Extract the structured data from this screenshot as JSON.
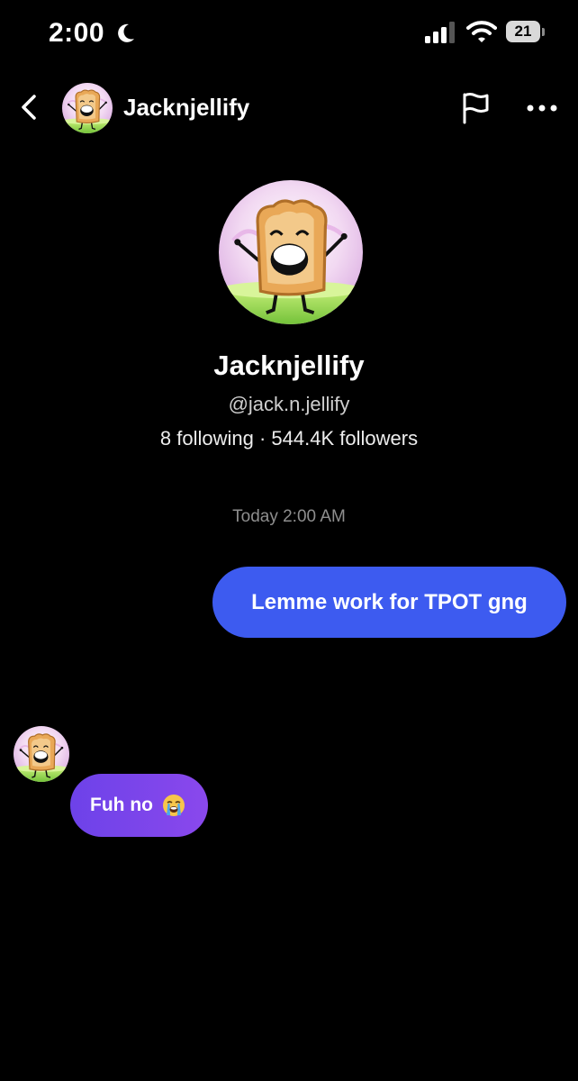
{
  "status_bar": {
    "time": "2:00",
    "battery_level": "21",
    "icons": [
      "moon-icon",
      "signal-icon",
      "wifi-icon",
      "battery-icon"
    ]
  },
  "header": {
    "name": "Jacknjellify",
    "icons": [
      "back-arrow-icon",
      "flag-icon",
      "more-icon"
    ]
  },
  "profile": {
    "display_name": "Jacknjellify",
    "handle": "@jack.n.jellify",
    "stats": "8 following · 544.4K followers"
  },
  "conversation": {
    "timestamp": "Today 2:00 AM",
    "messages": [
      {
        "direction": "outgoing",
        "text": "Lemme work for TPOT gng"
      },
      {
        "direction": "incoming",
        "text": "Fuh no",
        "emoji": "loudly-crying-face-icon"
      }
    ]
  },
  "colors": {
    "background": "#000000",
    "outgoing_bubble": "#3d5bf0",
    "incoming_bubble_start": "#6d42e9",
    "incoming_bubble_end": "#8a48ec",
    "timestamp_text": "#8e8e8e"
  }
}
